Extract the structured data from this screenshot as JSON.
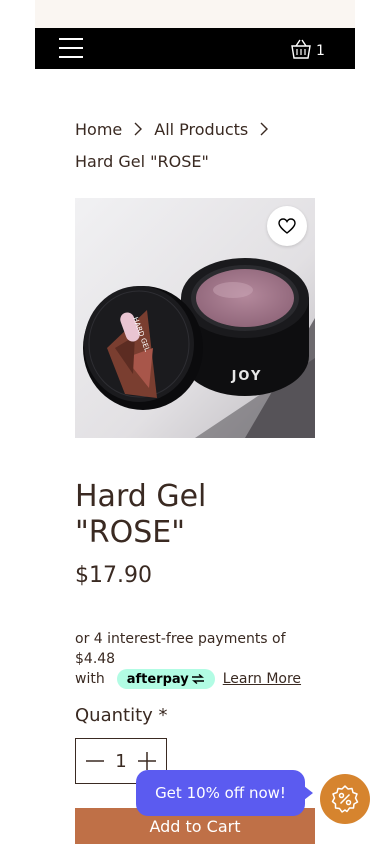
{
  "header": {
    "cart_count": "1"
  },
  "breadcrumb": {
    "home": "Home",
    "all_products": "All Products",
    "current": "Hard Gel \"ROSE\""
  },
  "product": {
    "image_brand_text": "JOY",
    "lid_text": "HARD GEL",
    "title": "Hard Gel \"ROSE\"",
    "price": "$17.90"
  },
  "afterpay": {
    "installments_text": "or 4 interest-free payments of $4.48",
    "with_label": "with",
    "badge_label": "afterpay",
    "learn_more": "Learn More"
  },
  "quantity": {
    "label": "Quantity *",
    "value": "1"
  },
  "add_to_cart_label": "Add to Cart",
  "promo": {
    "label": "Get 10% off now!",
    "icon": "percent-badge-icon"
  },
  "colors": {
    "header_bg": "#000000",
    "add_to_cart_bg": "#bf7047",
    "promo_bg": "#5b5bf0",
    "promo_circle_bg": "#d6842e",
    "afterpay_badge_bg": "#b2fce4",
    "text": "#3a2a22"
  }
}
